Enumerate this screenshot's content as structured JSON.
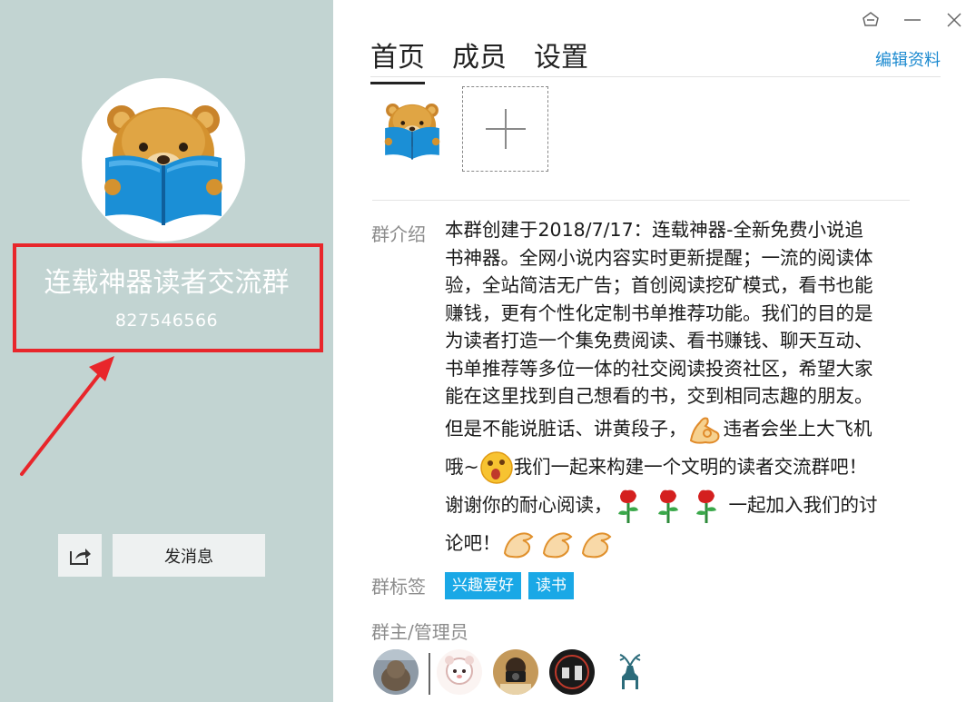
{
  "group": {
    "name": "连载神器读者交流群",
    "id": "827546566"
  },
  "actions": {
    "send_message": "发消息"
  },
  "tabs": [
    {
      "label": "首页",
      "active": true
    },
    {
      "label": "成员",
      "active": false
    },
    {
      "label": "设置",
      "active": false
    }
  ],
  "edit_profile": "编辑资料",
  "intro": {
    "label": "群介绍",
    "lines": [
      "本群创建于2018/7/17：连载神器-全新免费小说追",
      "书神器。全网小说内容实时更新提醒；一流的阅读体",
      "验，全站简洁无广告；首创阅读挖矿模式，看书也能",
      "赚钱，更有个性化定制书单推荐功能。我们的目的是",
      "为读者打造一个集免费阅读、看书赚钱、聊天互动、",
      "书单推荐等多位一体的社交阅读投资社区，希望大家",
      "能在这里找到自己想看的书，交到相同志趣的朋友。"
    ],
    "emoji_lines": [
      {
        "before": "但是不能说脏话、讲黄段子，",
        "after": "违者会坐上大飞机"
      },
      {
        "before": "哦~",
        "after": "我们一起来构建一个文明的读者交流群吧！"
      },
      {
        "before": "谢谢你的耐心阅读，",
        "after": "一起加入我们的讨"
      },
      {
        "before": "论吧！",
        "after": ""
      }
    ]
  },
  "tags": {
    "label": "群标签",
    "items": [
      "兴趣爱好",
      "读书"
    ]
  },
  "admins": {
    "label": "群主/管理员"
  },
  "colors": {
    "left_panel_bg": "#c2d4d2",
    "highlight": "#e8262b",
    "link": "#1c8ad0",
    "tag_bg": "#1aa8e6"
  }
}
